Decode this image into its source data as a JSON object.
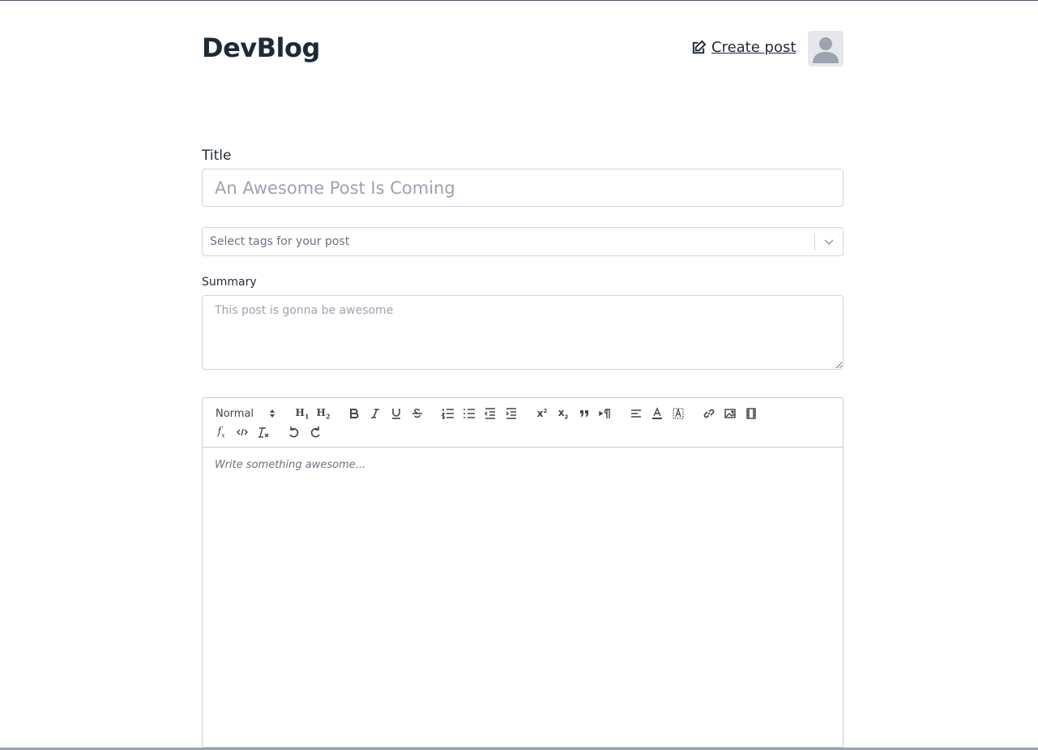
{
  "header": {
    "logo": "DevBlog",
    "create_post_label": "Create post"
  },
  "form": {
    "title_label": "Title",
    "title_placeholder": "An Awesome Post Is Coming",
    "tags_placeholder": "Select tags for your post",
    "summary_label": "Summary",
    "summary_placeholder": "This post is gonna be awesome"
  },
  "editor": {
    "format_select_value": "Normal",
    "body_placeholder": "Write something awesome...",
    "toolbar_row1": [
      "header-1",
      "header-2",
      "bold",
      "italic",
      "underline",
      "strikethrough",
      "ordered-list",
      "bullet-list",
      "outdent",
      "indent",
      "superscript",
      "subscript",
      "blockquote",
      "direction-rtl",
      "align-left",
      "text-color",
      "background-color",
      "link",
      "image",
      "video"
    ],
    "toolbar_row2": [
      "formula",
      "code-block",
      "clear-formatting",
      "undo",
      "redo"
    ]
  }
}
